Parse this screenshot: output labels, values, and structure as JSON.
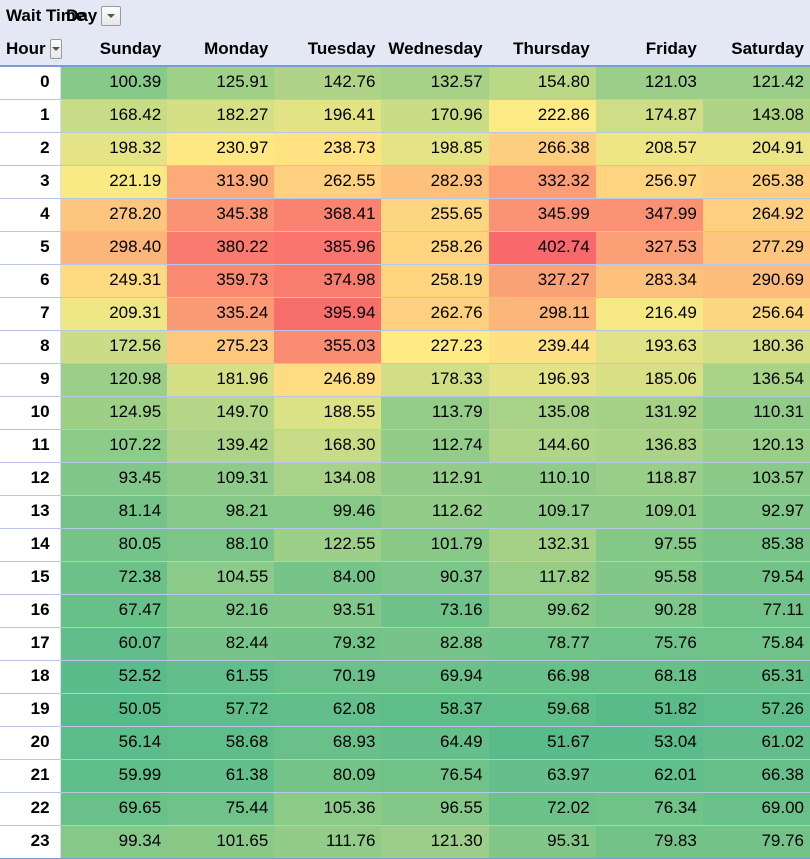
{
  "chart_data": {
    "type": "heatmap",
    "title": "Wait Time",
    "row_field": "Hour",
    "col_field": "Day",
    "columns": [
      "Sunday",
      "Monday",
      "Tuesday",
      "Wednesday",
      "Thursday",
      "Friday",
      "Saturday"
    ],
    "rows": [
      "0",
      "1",
      "2",
      "3",
      "4",
      "5",
      "6",
      "7",
      "8",
      "9",
      "10",
      "11",
      "12",
      "13",
      "14",
      "15",
      "16",
      "17",
      "18",
      "19",
      "20",
      "21",
      "22",
      "23"
    ],
    "values": [
      [
        100.39,
        125.91,
        142.76,
        132.57,
        154.8,
        121.03,
        121.42
      ],
      [
        168.42,
        182.27,
        196.41,
        170.96,
        222.86,
        174.87,
        143.08
      ],
      [
        198.32,
        230.97,
        238.73,
        198.85,
        266.38,
        208.57,
        204.91
      ],
      [
        221.19,
        313.9,
        262.55,
        282.93,
        332.32,
        256.97,
        265.38
      ],
      [
        278.2,
        345.38,
        368.41,
        255.65,
        345.99,
        347.99,
        264.92
      ],
      [
        298.4,
        380.22,
        385.96,
        258.26,
        402.74,
        327.53,
        277.29
      ],
      [
        249.31,
        359.73,
        374.98,
        258.19,
        327.27,
        283.34,
        290.69
      ],
      [
        209.31,
        335.24,
        395.94,
        262.76,
        298.11,
        216.49,
        256.64
      ],
      [
        172.56,
        275.23,
        355.03,
        227.23,
        239.44,
        193.63,
        180.36
      ],
      [
        120.98,
        181.96,
        246.89,
        178.33,
        196.93,
        185.06,
        136.54
      ],
      [
        124.95,
        149.7,
        188.55,
        113.79,
        135.08,
        131.92,
        110.31
      ],
      [
        107.22,
        139.42,
        168.3,
        112.74,
        144.6,
        136.83,
        120.13
      ],
      [
        93.45,
        109.31,
        134.08,
        112.91,
        110.1,
        118.87,
        103.57
      ],
      [
        81.14,
        98.21,
        99.46,
        112.62,
        109.17,
        109.01,
        92.97
      ],
      [
        80.05,
        88.1,
        122.55,
        101.79,
        132.31,
        97.55,
        85.38
      ],
      [
        72.38,
        104.55,
        84.0,
        90.37,
        117.82,
        95.58,
        79.54
      ],
      [
        67.47,
        92.16,
        93.51,
        73.16,
        99.62,
        90.28,
        77.11
      ],
      [
        60.07,
        82.44,
        79.32,
        82.88,
        78.77,
        75.76,
        75.84
      ],
      [
        52.52,
        61.55,
        70.19,
        69.94,
        66.98,
        68.18,
        65.31
      ],
      [
        50.05,
        57.72,
        62.08,
        58.37,
        59.68,
        51.82,
        57.26
      ],
      [
        56.14,
        58.68,
        68.93,
        64.49,
        51.67,
        53.04,
        61.02
      ],
      [
        59.99,
        61.38,
        80.09,
        76.54,
        63.97,
        62.01,
        66.38
      ],
      [
        69.65,
        75.44,
        105.36,
        96.55,
        72.02,
        76.34,
        69.0
      ],
      [
        99.34,
        101.65,
        111.76,
        121.3,
        95.31,
        79.83,
        79.76
      ]
    ],
    "value_range": [
      50.05,
      402.74
    ],
    "color_scale": {
      "low": "#57BB8A",
      "mid": "#FFEB84",
      "high": "#F8696B"
    }
  },
  "labels": {
    "measure": "Wait Time",
    "col_field": "Day",
    "row_field": "Hour"
  }
}
